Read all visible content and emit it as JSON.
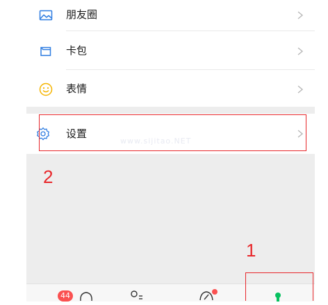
{
  "menu": {
    "moments": "朋友圈",
    "card_pack": "卡包",
    "stickers": "表情",
    "settings": "设置"
  },
  "annotations": {
    "step1": "1",
    "step2": "2"
  },
  "tabbar": {
    "chats_badge": "44"
  },
  "watermark": "www.sijitao.NET",
  "colors": {
    "annotation_red": "#e8262a",
    "accent_green": "#07c160",
    "badge_red": "#fa5151",
    "icon_blue": "#2f7de1",
    "sticker_yellow": "#f5b400"
  },
  "icons": {
    "moments": "landscape-photo-icon",
    "card_pack": "wallet-icon",
    "stickers": "smiley-icon",
    "settings": "gear-icon",
    "chevron": "chevron-right-icon"
  }
}
